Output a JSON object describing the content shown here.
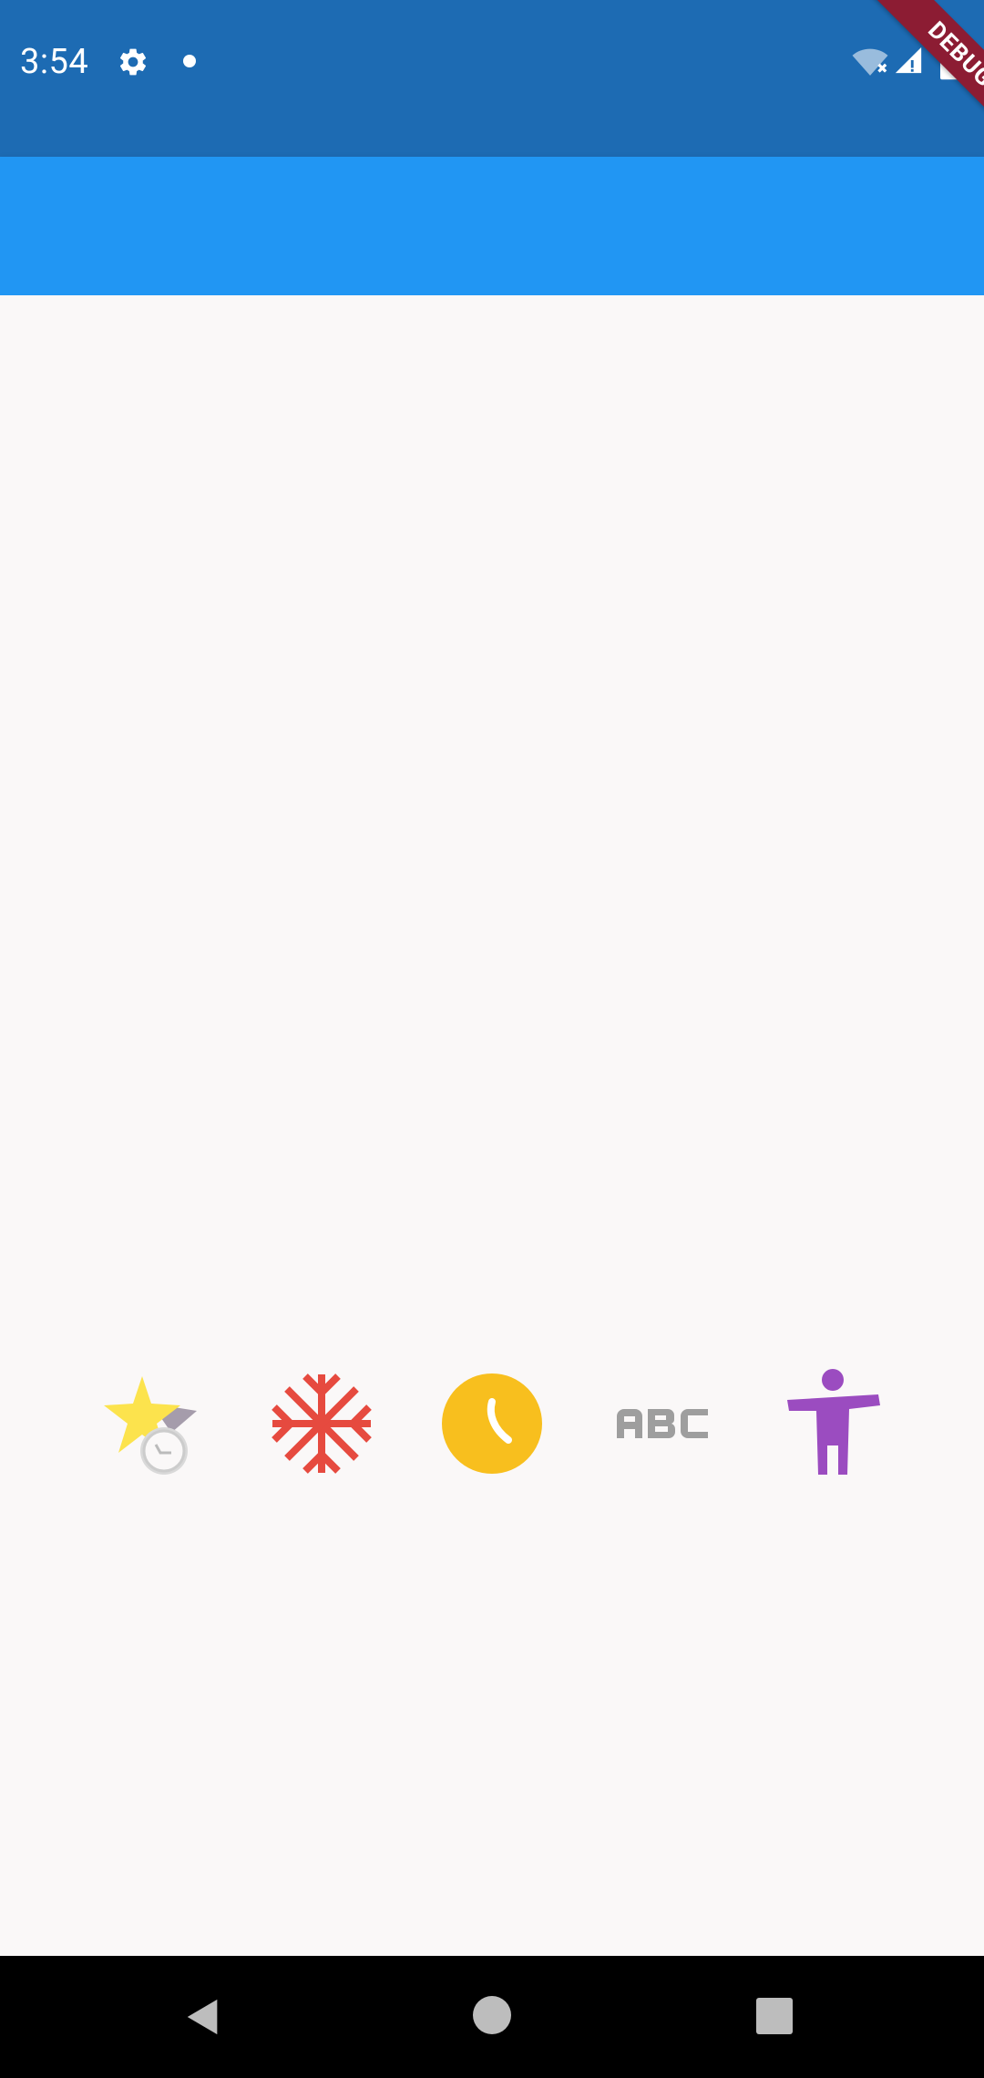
{
  "status_bar": {
    "time": "3:54",
    "icons": [
      "gear-icon",
      "notification-dot-icon",
      "wifi-off-icon",
      "signal-icon",
      "battery-icon"
    ]
  },
  "debug_banner": {
    "label": "DEBUG",
    "color": "#8C1C33"
  },
  "app_bar": {
    "title": "",
    "color": "#2196F3"
  },
  "icon_row": [
    {
      "name": "star-medal-icon",
      "color": "#FCE34D"
    },
    {
      "name": "snowflake-icon",
      "color": "#E64A3F"
    },
    {
      "name": "clock-icon",
      "color": "#F8BF1E"
    },
    {
      "name": "abc-icon",
      "color": "#9E9E9E"
    },
    {
      "name": "accessibility-icon",
      "color": "#9B4CC0"
    }
  ],
  "nav_bar": {
    "buttons": [
      "back-button",
      "home-button",
      "recents-button"
    ]
  }
}
